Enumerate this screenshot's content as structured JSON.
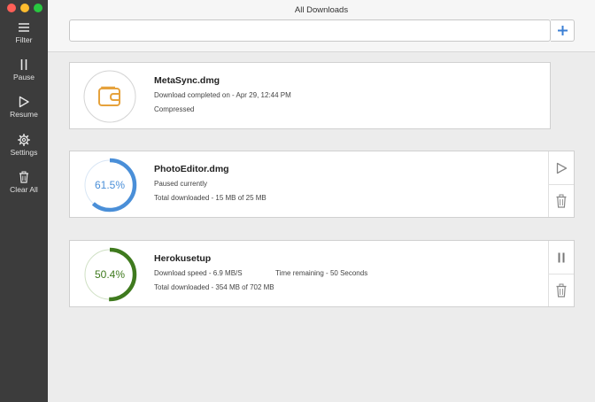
{
  "window": {
    "title": "All Downloads"
  },
  "sidebar": {
    "items": [
      {
        "label": "Filter",
        "icon": "menu-icon"
      },
      {
        "label": "Pause",
        "icon": "pause-icon"
      },
      {
        "label": "Resume",
        "icon": "play-icon"
      },
      {
        "label": "Settings",
        "icon": "gear-icon"
      },
      {
        "label": "Clear All",
        "icon": "trash-icon"
      }
    ]
  },
  "search": {
    "value": "",
    "placeholder": ""
  },
  "downloads": [
    {
      "name": "MetaSync.dmg",
      "line1": "Download completed on - Apr 29, 12:44 PM",
      "line2": "Compressed",
      "status": "completed",
      "icon": "wallet-icon"
    },
    {
      "name": "PhotoEditor.dmg",
      "progress_label": "61.5%",
      "progress": 0.615,
      "line1": "Paused currently",
      "line2": "Total downloaded - 15 MB of 25 MB",
      "status": "paused"
    },
    {
      "name": "Herokusetup",
      "progress_label": "50.4%",
      "progress": 0.504,
      "line1": "Download speed - 6.9 MB/S",
      "line1b": "Time remaining - 50 Seconds",
      "line2": "Total downloaded - 354 MB of 702 MB",
      "status": "downloading"
    }
  ],
  "colors": {
    "sidebar_bg": "#3c3c3c",
    "accent_blue": "#4a8fd8",
    "accent_green": "#3f7a1e",
    "completed_orange": "#e6a23c",
    "traffic_red": "#fe5f57",
    "traffic_yellow": "#febc2e",
    "traffic_green": "#28c840"
  }
}
